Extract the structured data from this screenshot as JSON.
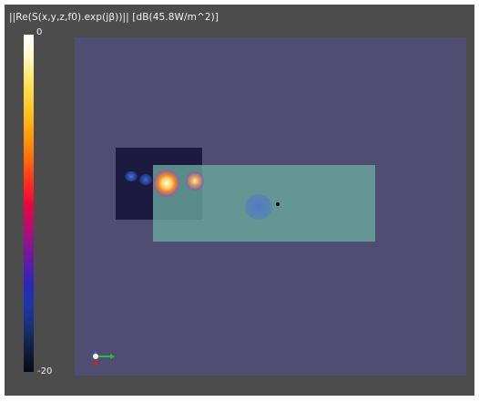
{
  "colorbar": {
    "title": "||Re(S(x,y,z,f0).exp(jβ))|| [dB(45.8W/m^2)]",
    "max_label": "0",
    "min_label": "-20"
  },
  "colors": {
    "viewport_bg": "#4c4c4c",
    "plane": "#4f4e72",
    "dark_block": "#1c1b3f",
    "teal_block": "#6aaa9e",
    "hotspot_core": "#fffbe8"
  },
  "icons": {
    "axes": "xyz-axes-triad-icon"
  }
}
